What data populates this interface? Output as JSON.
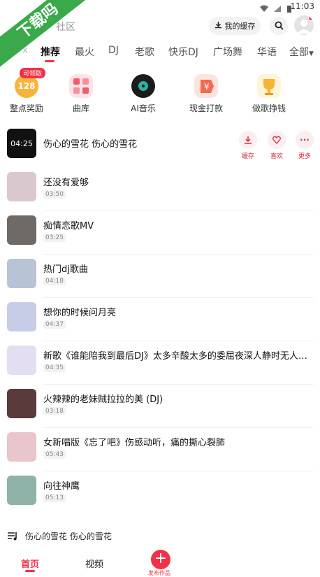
{
  "status_bar": {
    "time": "11:03"
  },
  "watermark": "下载吗",
  "topbar": {
    "community_label": "社区",
    "cache_label": "我的缓存"
  },
  "tabs": [
    {
      "label": "x"
    },
    {
      "label": "推荐"
    },
    {
      "label": "最火"
    },
    {
      "label": "DJ"
    },
    {
      "label": "老歌"
    },
    {
      "label": "快乐DJ"
    },
    {
      "label": "广场舞"
    },
    {
      "label": "华语"
    },
    {
      "label": "全部"
    }
  ],
  "features": [
    {
      "label": "整点奖励",
      "badge": "可领取",
      "value": "128"
    },
    {
      "label": "曲库"
    },
    {
      "label": "AI音乐"
    },
    {
      "label": "现金打款"
    },
    {
      "label": "做歌挣钱"
    }
  ],
  "songs": [
    {
      "title": "伤心的雪花 伤心的雪花",
      "duration": "04:25",
      "color": "#1b1b1b"
    },
    {
      "title": "还没有爱够",
      "duration": "03:50",
      "color": "#d9c9cf"
    },
    {
      "title": "痴情恋歌MV",
      "duration": "03:25",
      "color": "#6f6a66"
    },
    {
      "title": "热门dj歌曲",
      "duration": "04:18",
      "color": "#b9c3d6"
    },
    {
      "title": "想你的时候问月亮",
      "duration": "04:37",
      "color": "#c7cde6"
    },
    {
      "title": "新歌《谁能陪我到最后DJ》太多辛酸太多的委屈夜深人静时无人倾诉",
      "duration": "04:35",
      "color": "#e3def1"
    },
    {
      "title": "火辣辣的老妹贼拉拉的美 (DJ)",
      "duration": "03:18",
      "color": "#5a3a3a"
    },
    {
      "title": "女新唱版《忘了吧》伤感动听，痛的撕心裂肺",
      "duration": "05:43",
      "color": "#e8c6cb"
    },
    {
      "title": "向往神鹰",
      "duration": "05:13",
      "color": "#8fb3a8"
    }
  ],
  "row_actions": [
    {
      "label": "缓存"
    },
    {
      "label": "喜欢"
    },
    {
      "label": "更多"
    }
  ],
  "player": {
    "now_playing": "伤心的雪花 伤心的雪花"
  },
  "nav": {
    "home": "首页",
    "video": "视频",
    "publish": "发布作品"
  },
  "colors": {
    "accent": "#f03146",
    "action_bg": "#fbeef0"
  }
}
